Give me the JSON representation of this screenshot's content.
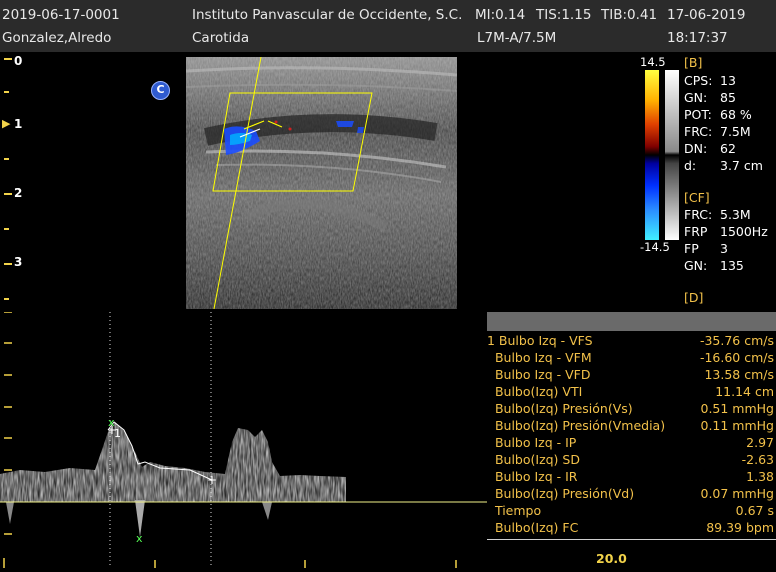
{
  "header": {
    "study_id": "2019-06-17-0001",
    "patient_name": "Gonzalez,Alredo",
    "institution": "Instituto Panvascular de Occidente, S.C.",
    "mi": "MI:0.14",
    "tis": "TIS:1.15",
    "tib": "TIB:0.41",
    "date": "17-06-2019",
    "exam": "Carotida",
    "probe": "L7M-A/7.5M",
    "time": "18:17:37"
  },
  "depth_scale": {
    "labels": [
      "0",
      "1",
      "2",
      "3"
    ],
    "focus_marker": "▶"
  },
  "color_scale": {
    "max": "14.5",
    "min": "-14.5",
    "marker": "C"
  },
  "b_params": {
    "header": "[B]",
    "items": [
      {
        "label": "CPS:",
        "value": "13"
      },
      {
        "label": "GN:",
        "value": "85"
      },
      {
        "label": "POT:",
        "value": "68 %"
      },
      {
        "label": "FRC:",
        "value": "7.5M"
      },
      {
        "label": "DN:",
        "value": "62"
      },
      {
        "label": "d:",
        "value": "3.7 cm"
      }
    ]
  },
  "cf_params": {
    "header": "[CF]",
    "items": [
      {
        "label": "FRC:",
        "value": "5.3M"
      },
      {
        "label": "FRP",
        "value": "1500Hz"
      },
      {
        "label": "FP",
        "value": "3"
      },
      {
        "label": "GN:",
        "value": "135"
      }
    ]
  },
  "d_params": {
    "header": "[D]"
  },
  "measurements": [
    {
      "label": "1 Bulbo Izq - VFS",
      "value": "-35.76 cm/s"
    },
    {
      "label": "  Bulbo Izq - VFM",
      "value": "-16.60 cm/s"
    },
    {
      "label": "  Bulbo Izq - VFD",
      "value": "13.58 cm/s"
    },
    {
      "label": "  Bulbo(Izq) VTI",
      "value": "11.14 cm"
    },
    {
      "label": "  Bulbo(Izq) Presión(Vs)",
      "value": "0.51 mmHg"
    },
    {
      "label": "  Bulbo(Izq) Presión(Vmedia)",
      "value": "0.11 mmHg"
    },
    {
      "label": "  Bulbo Izq - IP",
      "value": "2.97"
    },
    {
      "label": "  Bulbo(Izq) SD",
      "value": "-2.63"
    },
    {
      "label": "  Bulbo Izq - IR",
      "value": "1.38"
    },
    {
      "label": "  Bulbo(Izq) Presión(Vd)",
      "value": "0.07 mmHg"
    },
    {
      "label": "  Tiempo",
      "value": "0.67 s"
    },
    {
      "label": "  Bulbo(Izq) FC",
      "value": "89.39 bpm"
    }
  ],
  "doppler": {
    "cursor_label": "1",
    "sweep_value": "20.0"
  },
  "colors": {
    "accent_yellow": "#f2d34a",
    "label_orange": "#f2c14a",
    "header_bg": "#2b2b2b",
    "panel_bar": "#6a6a6a",
    "marker_blue": "#2f5bd0"
  }
}
